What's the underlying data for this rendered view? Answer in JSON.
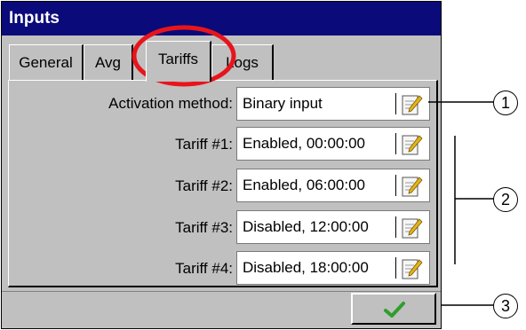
{
  "window": {
    "title": "Inputs"
  },
  "tabs": [
    {
      "label": "General"
    },
    {
      "label": "Avg"
    },
    {
      "label": "Tariffs"
    },
    {
      "label": "Logs"
    }
  ],
  "form": {
    "activation": {
      "label": "Activation method:",
      "value": "Binary input"
    },
    "tariffs": [
      {
        "label": "Tariff #1:",
        "value": "Enabled, 00:00:00"
      },
      {
        "label": "Tariff #2:",
        "value": "Enabled, 06:00:00"
      },
      {
        "label": "Tariff #3:",
        "value": "Disabled, 12:00:00"
      },
      {
        "label": "Tariff #4:",
        "value": "Disabled, 18:00:00"
      }
    ]
  },
  "callouts": [
    "1",
    "2",
    "3"
  ],
  "colors": {
    "titlebar": "#0a0a7a",
    "highlight": "#e8141c",
    "ok_check": "#2e9e2e"
  },
  "icons": {
    "edit": "notepad-edit-icon",
    "ok": "checkmark-icon"
  }
}
